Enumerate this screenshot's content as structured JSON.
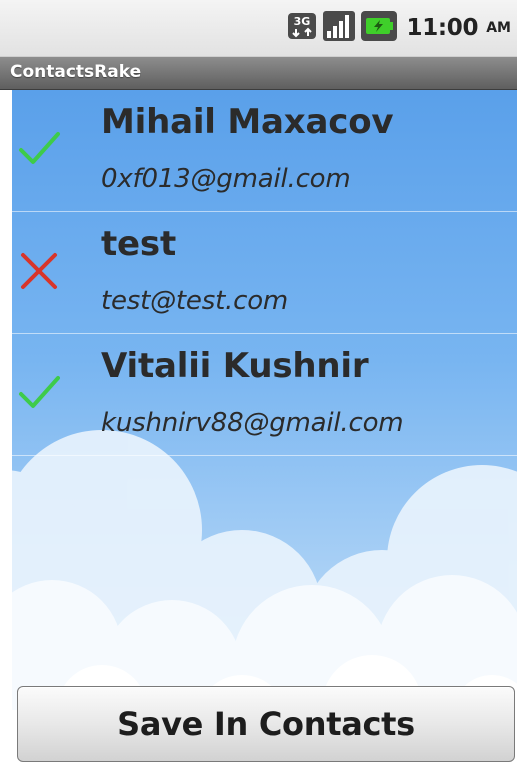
{
  "status_bar": {
    "network_badge": "3G",
    "time": "11:00",
    "ampm": "AM",
    "icons": [
      "network-3g-icon",
      "signal-strength-icon",
      "battery-charging-icon"
    ]
  },
  "app": {
    "title": "ContactsRake"
  },
  "contacts": [
    {
      "name": "Mihail Maxacov",
      "email": "0xf013@gmail.com",
      "status": "checked"
    },
    {
      "name": "test",
      "email": "test@test.com",
      "status": "rejected"
    },
    {
      "name": "Vitalii Kushnir",
      "email": "kushnirv88@gmail.com",
      "status": "checked"
    }
  ],
  "actions": {
    "save_label": "Save In Contacts"
  },
  "colors": {
    "check": "#3ecb4a",
    "cross": "#d8352a",
    "sky_top": "#5aa0ea",
    "title_bar": "#707070"
  }
}
